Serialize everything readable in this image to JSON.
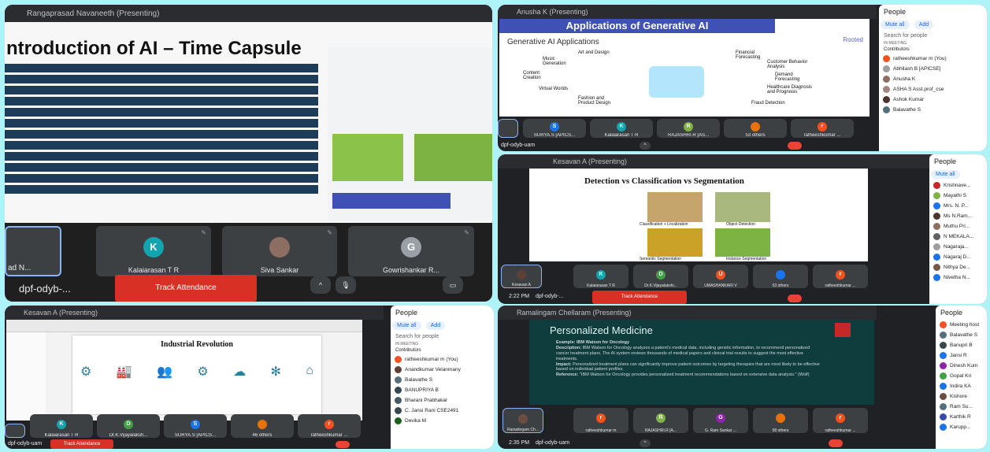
{
  "panel1": {
    "presenter": "Rangaprasad Navaneeth (Presenting)",
    "slide_title": "ntroduction of AI – Time Capsule",
    "tiles": [
      {
        "label": "ad N...",
        "initial": ""
      },
      {
        "label": "Kalaiarasan T R",
        "initial": "K"
      },
      {
        "label": "Siva Sankar",
        "initial": ""
      },
      {
        "label": "Gowrishankar R...",
        "initial": "G"
      }
    ],
    "meet_code": "dpf-odyb-...",
    "track_label": "Track Attendance",
    "colors": {
      "k": "#12a4af",
      "g": "#9aa0a6"
    }
  },
  "panel2": {
    "presenter": "Anusha K (Presenting)",
    "slide_title": "Applications of Generative AI",
    "slide_subtitle": "Generative AI Applications",
    "logo": "Rooted",
    "diagram_labels": [
      "Art and Design",
      "Music Generation",
      "Content Creation",
      "Virtual Worlds",
      "Fashion and Product Design",
      "Financial Forecasting",
      "Customer Behavior Analysis",
      "Demand Forecasting",
      "Healthcare Diagnosis and Prognosis",
      "Fraud Detection"
    ],
    "tiles": [
      {
        "label": "SURYA.S [APICS...",
        "initial": "S"
      },
      {
        "label": "Kalaiarasan T R",
        "initial": "K"
      },
      {
        "label": "RAJASHRI.R [AS...",
        "initial": "R"
      },
      {
        "label": "53 others",
        "initial": ""
      },
      {
        "label": "ratheeshkumar ...",
        "initial": "r"
      }
    ],
    "meet_code": "dpf-odyb-uam",
    "people_title": "People",
    "mute_all": "Mute all",
    "add": "Add",
    "search_placeholder": "Search for people",
    "section": "IN MEETING",
    "contributors": "Contributors",
    "people": [
      "ratheeshkumar m (You)",
      "Abhilash B [APICSE]",
      "Anusha K",
      "ASHA S Asst.prof_cse",
      "Ashok Kumar",
      "Balavathe S"
    ]
  },
  "panel3": {
    "presenter": "Kesavan A (Presenting)",
    "slide_title": "Detection vs Classification vs Segmentation",
    "captions": [
      "Classification + Localization",
      "Object Detection",
      "Semantic Segmentation",
      "Instance Segmentation"
    ],
    "tiles": [
      {
        "label": "Kesavan A",
        "initial": ""
      },
      {
        "label": "Kalaiarasan T R",
        "initial": "K"
      },
      {
        "label": "Dr.K.Vijayalakshi...",
        "initial": "D"
      },
      {
        "label": "UMASHANKARI V",
        "initial": "U"
      },
      {
        "label": "53 others",
        "initial": ""
      },
      {
        "label": "ratheeshkumar ...",
        "initial": "r"
      }
    ],
    "time": "2:22 PM",
    "meet_code": "dpf-odyb-...",
    "track_label": "Track Attendance",
    "people_title": "People",
    "mute_all": "Mute all",
    "people": [
      "Krishnave...",
      "Mayathi S",
      "Mrs. N. P...",
      "Ms N.Ram...",
      "Muthu Pri...",
      "N MEKALA...",
      "Nagaraja...",
      "Nagaraj D...",
      "Nithya De...",
      "Nivetha N..."
    ]
  },
  "panel4": {
    "presenter": "Kesavan A (Presenting)",
    "slide_title": "Industrial Revolution",
    "tiles": [
      {
        "label": "Kalaiarasan T R",
        "initial": "K"
      },
      {
        "label": "Dr.K.Vijayalaksh...",
        "initial": "D"
      },
      {
        "label": "SURYA.S [APICS...",
        "initial": "S"
      },
      {
        "label": "46 others",
        "initial": ""
      },
      {
        "label": "ratheeshkumar ...",
        "initial": "r"
      }
    ],
    "meet_code": "dpf-odyb-uam",
    "track_label": "Track Attendance",
    "people_title": "People",
    "mute_all": "Mute all",
    "add": "Add",
    "search_placeholder": "Search for people",
    "section": "IN MEETING",
    "contributors": "Contributors",
    "people": [
      "ratheeshkumar m (You)",
      "Anandkumar Velanmany",
      "Balavathe S",
      "BANUPRIYA B",
      "Bharani Prabhakar",
      "C. Jansi Rani CSE2491",
      "Devika M"
    ]
  },
  "panel5": {
    "presenter": "Ramalingam Chellaram (Presenting)",
    "slide_title": "Personalized Medicine",
    "example": "Example: IBM Watson for Oncology",
    "description_label": "Description:",
    "description": "IBM Watson for Oncology analyzes a patient's medical data, including genetic information, to recommend personalized cancer treatment plans. The AI system reviews thousands of medical papers and clinical trial results to suggest the most effective treatments.",
    "impact_label": "Impact:",
    "impact": "Personalized treatment plans can significantly improve patient outcomes by targeting therapies that are most likely to be effective based on individual patient profiles.",
    "reference_label": "Reference:",
    "reference": "\"IBM Watson for Oncology provides personalized treatment recommendations based on extensive data analysis.\" (Wolf)",
    "tiles": [
      {
        "label": "Ramalingam Ch...",
        "initial": ""
      },
      {
        "label": "ratheeshkumar m",
        "initial": "r"
      },
      {
        "label": "RAJASHRI.R [A...",
        "initial": "R"
      },
      {
        "label": "G. Ram Sankar ...",
        "initial": "G"
      },
      {
        "label": "58 others",
        "initial": ""
      },
      {
        "label": "ratheeshkumar ...",
        "initial": "r"
      }
    ],
    "time": "2:35 PM",
    "meet_code": "dpf-odyb-uam",
    "people_title": "People",
    "people": [
      "Meeting host",
      "Balavathe S",
      "Banupri B",
      "Jansi R",
      "Dinesh Kum",
      "Gopal Kri",
      "Indira KA",
      "Kishore",
      "Ram Su...",
      "Karthik R",
      "Karupp..."
    ]
  }
}
